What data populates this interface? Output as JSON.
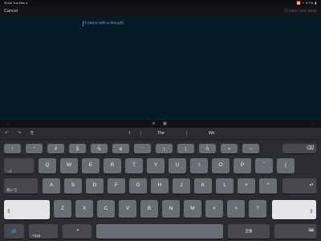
{
  "status": {
    "time": "20:04",
    "date": "Tue Dec 4",
    "right": "📶 ◔ 97% ▮"
  },
  "navbar": {
    "cancel": "Cancel",
    "create": "Create new blog"
  },
  "compose": {
    "placeholder": "It starts with a thought"
  },
  "suggestions": {
    "left": "I",
    "middle": "The",
    "right": "We"
  },
  "keys": {
    "num_row": [
      {
        "top": "~",
        "main": "!"
      },
      {
        "top": "`",
        "main": "\""
      },
      {
        "top": "#",
        "main": "#"
      },
      {
        "top": "$",
        "main": "$"
      },
      {
        "top": "%",
        "main": "%"
      },
      {
        "top": "^",
        "main": "&"
      },
      {
        "top": "'",
        "main": "'"
      },
      {
        "top": "",
        "main": "("
      },
      {
        "top": "",
        "main": ")"
      },
      {
        "top": "0",
        "main": "0"
      },
      {
        "top": "_",
        "main": "="
      },
      {
        "top": "",
        "main": "~"
      }
    ],
    "delete": "⌫",
    "row1": [
      "Q",
      "W",
      "E",
      "R",
      "T",
      "Y",
      "U",
      "I",
      "O",
      "P",
      "`",
      "{"
    ],
    "tab": "→|",
    "row2": [
      "A",
      "S",
      "D",
      "F",
      "G",
      "H",
      "J",
      "K",
      "L",
      "+",
      "*"
    ],
    "lang": "あいう",
    "return": "↵",
    "row3": [
      "Z",
      "X",
      "C",
      "V",
      "B",
      "N",
      "M",
      "<",
      ">",
      "?"
    ],
    "shift": "⇧",
    "globe": "🌐",
    "num": ".?123",
    "mic": "🎤",
    "fullwidth": "全角",
    "hide": "⌨"
  }
}
